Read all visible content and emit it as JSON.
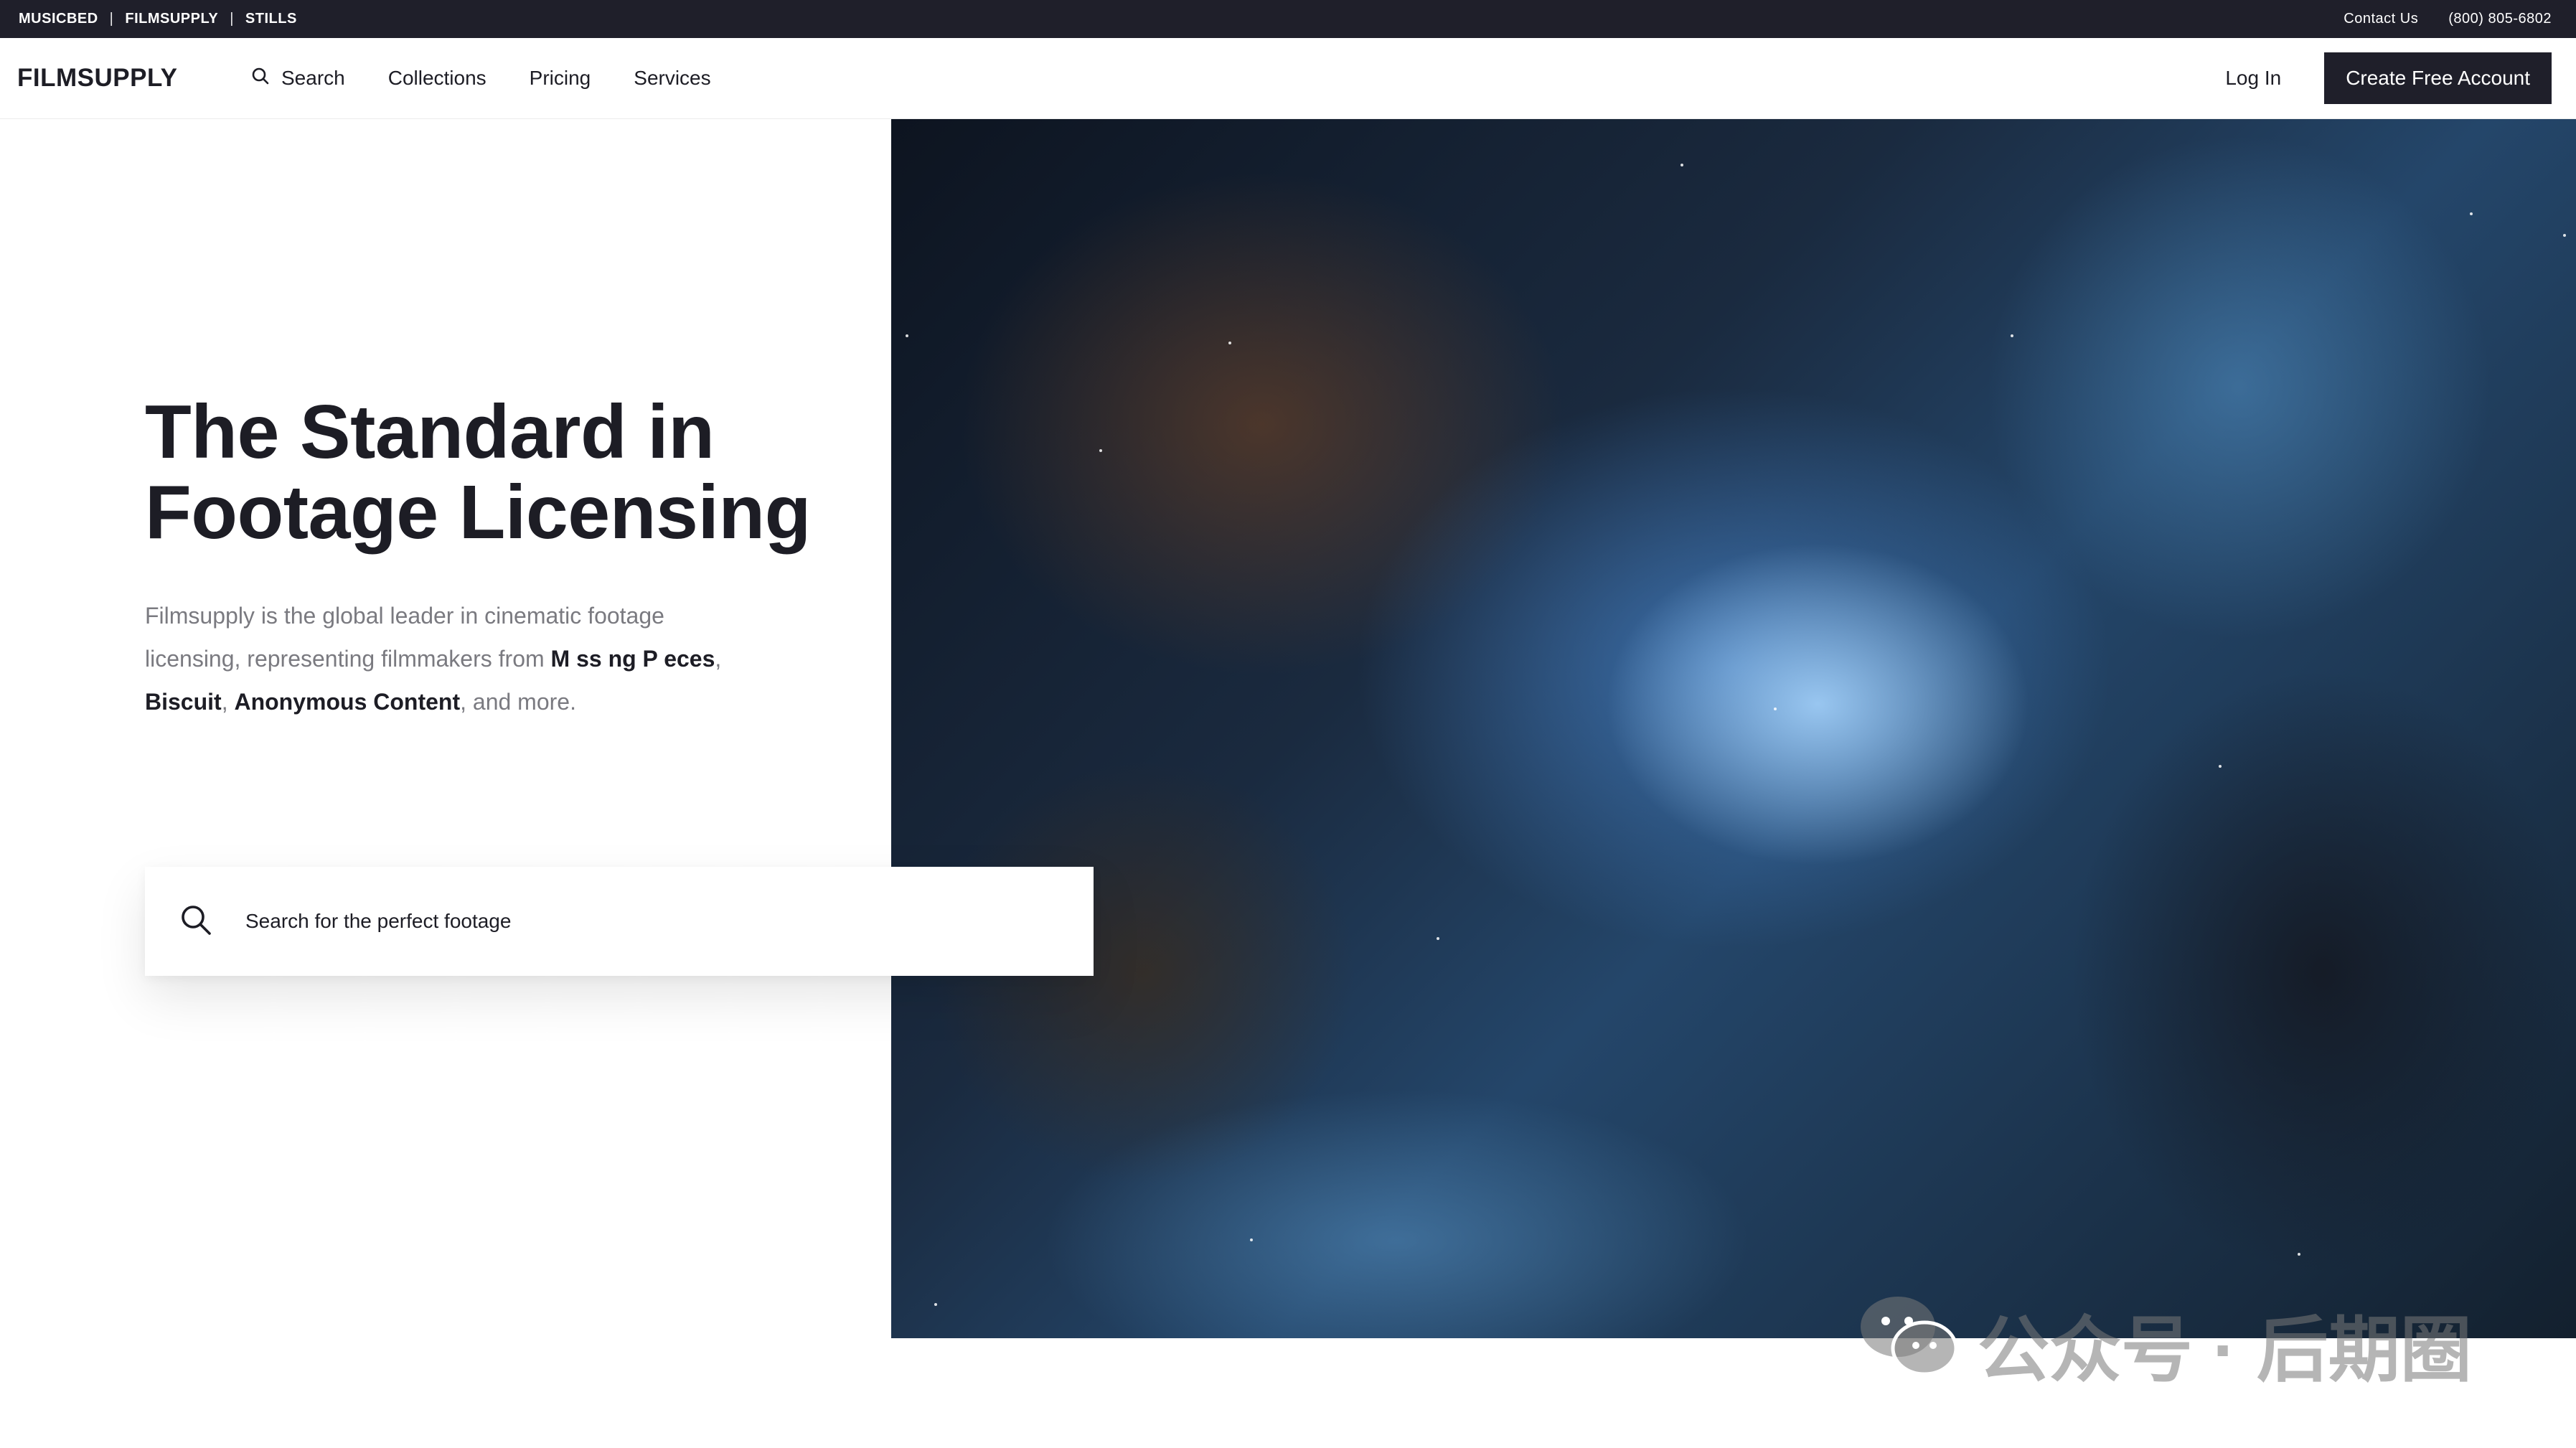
{
  "topbar": {
    "brands": [
      "MUSICBED",
      "FILMSUPPLY",
      "STILLS"
    ],
    "separator": "|",
    "contact": "Contact Us",
    "phone": "(800) 805-6802"
  },
  "nav": {
    "logo": "FILMSUPPLY",
    "search": "Search",
    "collections": "Collections",
    "pricing": "Pricing",
    "services": "Services",
    "login": "Log In",
    "create_account": "Create Free Account"
  },
  "hero": {
    "title_line1": "The Standard in",
    "title_line2": "Footage Licensing",
    "desc_part1": "Filmsupply is the global leader in cinematic footage licensing, representing filmmakers from ",
    "partner1": "M ss ng P eces",
    "comma1": ",",
    "partner2": "Biscuit",
    "comma2": ", ",
    "partner3": "Anonymous Content",
    "desc_part2": ", and more."
  },
  "search": {
    "placeholder": "Search for the perfect footage",
    "icon": "search-icon"
  },
  "watermark": {
    "text": "公众号 · 后期圈",
    "icon": "wechat-icon"
  }
}
